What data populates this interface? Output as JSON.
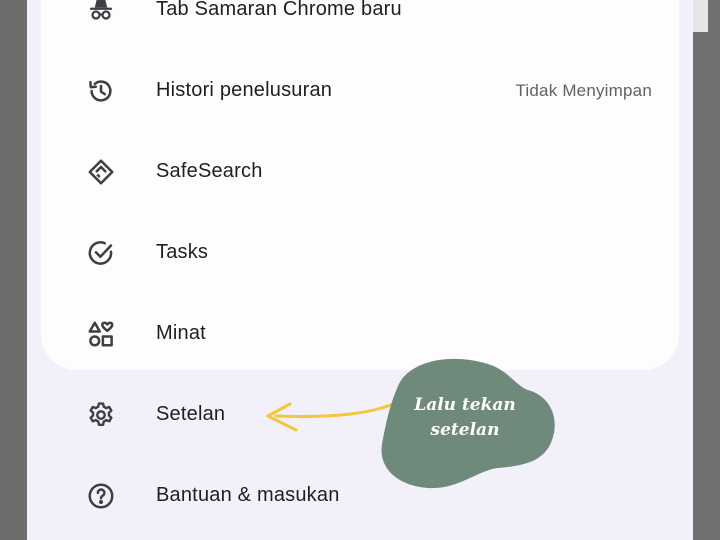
{
  "menu": {
    "items": [
      {
        "label": "Tab Samaran Chrome baru",
        "icon": "incognito-icon",
        "meta": ""
      },
      {
        "label": "Histori penelusuran",
        "icon": "history-icon",
        "meta": "Tidak Menyimpan"
      },
      {
        "label": "SafeSearch",
        "icon": "safesearch-icon",
        "meta": ""
      },
      {
        "label": "Tasks",
        "icon": "tasks-check-icon",
        "meta": ""
      },
      {
        "label": "Minat",
        "icon": "interests-icon",
        "meta": ""
      },
      {
        "label": "Setelan",
        "icon": "gear-icon",
        "meta": ""
      },
      {
        "label": "Bantuan & masukan",
        "icon": "help-icon",
        "meta": ""
      }
    ]
  },
  "annotation": {
    "line1": "Lalu tekan",
    "line2": "setelan",
    "blob_color": "#6f8a7a",
    "arrow_color": "#f4c63d"
  },
  "colors": {
    "card": "#fefcfc",
    "sheet": "#f2f1fa",
    "text": "#1f1f1f",
    "secondary_text": "#5f6368"
  }
}
